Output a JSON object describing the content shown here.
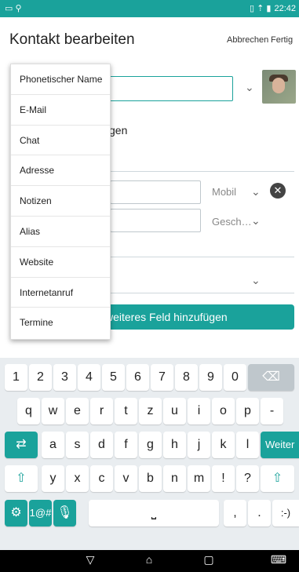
{
  "status": {
    "time": "22:42",
    "left_icons": "▭ ⚲",
    "right_icons": "▯ ⇡ ▮"
  },
  "header": {
    "title": "Kontakt bearbeiten",
    "cancel": "Abbrechen",
    "done": "Fertig"
  },
  "form": {
    "partial_text": "gen",
    "phone_label": "Mobil",
    "phone_label2": "Gesch…",
    "add_field": "weiteres Feld hinzufügen"
  },
  "menu": {
    "items": [
      "Phonetischer Name",
      "E-Mail",
      "Chat",
      "Adresse",
      "Notizen",
      "Alias",
      "Website",
      "Internetanruf",
      "Termine"
    ]
  },
  "keyboard": {
    "row1": [
      "1",
      "2",
      "3",
      "4",
      "5",
      "6",
      "7",
      "8",
      "9",
      "0"
    ],
    "row2": [
      "q",
      "w",
      "e",
      "r",
      "t",
      "z",
      "u",
      "i",
      "o",
      "p",
      "-"
    ],
    "row3": [
      "a",
      "s",
      "d",
      "f",
      "g",
      "h",
      "j",
      "k",
      "l"
    ],
    "row4": [
      "y",
      "x",
      "c",
      "v",
      "b",
      "n",
      "m",
      "!",
      "?"
    ],
    "next": "Weiter",
    "symbols": "1@#",
    "comma": ",",
    "period": ".",
    "smiley": ":-)"
  },
  "icons": {
    "backspace": "backspace-icon",
    "tab": "tab-icon",
    "shift": "shift-icon",
    "settings": "gear-icon",
    "mic": "microphone-icon",
    "back": "back-icon",
    "home": "home-icon",
    "recents": "recents-icon",
    "keyboard": "keyboard-icon"
  }
}
